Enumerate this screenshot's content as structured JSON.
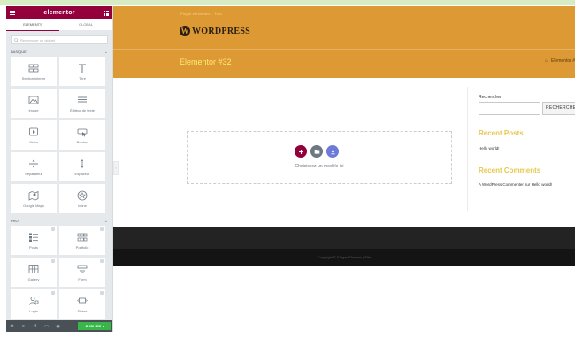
{
  "panel": {
    "logo": "elementor",
    "tabs": [
      {
        "label": "ELEMENTS",
        "active": true
      },
      {
        "label": "GLOBAL",
        "active": false
      }
    ],
    "search": {
      "placeholder": "Rechercher un widget"
    },
    "categories": [
      {
        "title": "BASIQUE",
        "widgets": [
          {
            "label": "Section interne",
            "icon": "columns-icon"
          },
          {
            "label": "Titre",
            "icon": "heading-icon"
          },
          {
            "label": "Image",
            "icon": "image-icon"
          },
          {
            "label": "Éditeur de texte",
            "icon": "text-editor-icon"
          },
          {
            "label": "Vidéo",
            "icon": "video-icon"
          },
          {
            "label": "Bouton",
            "icon": "button-icon"
          },
          {
            "label": "Séparateur",
            "icon": "divider-icon"
          },
          {
            "label": "Espaceur",
            "icon": "spacer-icon"
          },
          {
            "label": "Google Maps",
            "icon": "map-icon"
          },
          {
            "label": "Icône",
            "icon": "star-icon"
          }
        ]
      },
      {
        "title": "PRO",
        "widgets": [
          {
            "label": "Posts",
            "icon": "posts-icon"
          },
          {
            "label": "Portfolio",
            "icon": "portfolio-icon"
          },
          {
            "label": "Gallery",
            "icon": "gallery-icon"
          },
          {
            "label": "Form",
            "icon": "form-icon"
          },
          {
            "label": "Login",
            "icon": "login-icon"
          },
          {
            "label": "Slides",
            "icon": "slides-icon"
          }
        ]
      }
    ],
    "footer": {
      "publish": "PUBLIER"
    }
  },
  "site": {
    "tagline": "Plugin elementor – Tuto",
    "logo_letter": "W",
    "logo_text": "WORDPRESS",
    "page_title": "Elementor #32",
    "breadcrumb": [
      "⌂",
      "Elementor #"
    ]
  },
  "canvas": {
    "hint": "Choisissez un modèle ici"
  },
  "sidebar": {
    "search_label": "Rechercher",
    "search_button": "RECHERCHER",
    "recent_posts_title": "Recent Posts",
    "recent_post": "Hello world!",
    "recent_comments_title": "Recent Comments",
    "recent_comment": "A WordPress Commenter sur Hello world!"
  },
  "footer": {
    "copyright": "Copyright © ElegantThemes | Site"
  },
  "colors": {
    "elementor": "#93003c",
    "header": "#dd9933",
    "publish": "#39b54a",
    "accent": "#e6c84b"
  }
}
